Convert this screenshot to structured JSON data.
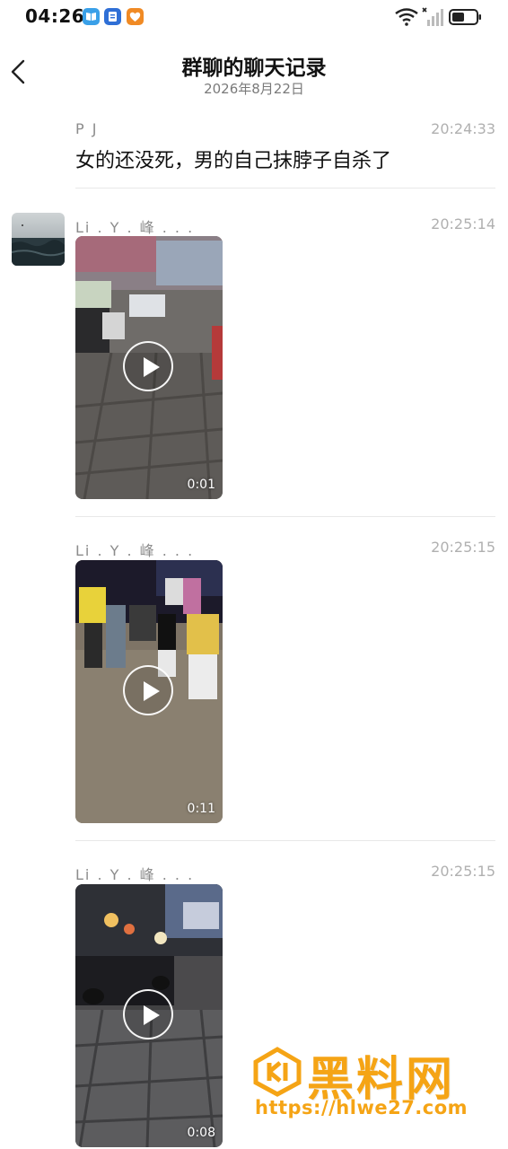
{
  "status_bar": {
    "time": "04:26",
    "app_icons": [
      "book-icon",
      "notes-icon",
      "heart-icon"
    ],
    "signal_icons": [
      "wifi-icon",
      "no-sim-signal-icon",
      "battery-icon"
    ]
  },
  "header": {
    "title": "群聊的聊天记录",
    "date": "2026年8月22日"
  },
  "messages": [
    {
      "sender": "P J",
      "time": "20:24:33",
      "text": "女的还没死，男的自己抹脖子自杀了"
    },
    {
      "sender": "Li . Y . 峰 . . .",
      "time": "20:25:14",
      "video_duration": "0:01"
    },
    {
      "sender": "Li . Y . 峰 . . .",
      "time": "20:25:15",
      "video_duration": "0:11"
    },
    {
      "sender": "Li . Y . 峰 . . .",
      "time": "20:25:15",
      "video_duration": "0:08"
    }
  ],
  "watermark": {
    "name": "黑料网",
    "url": "https://hlwe27.com"
  },
  "colors": {
    "background": "#ffffff",
    "watermark": "#f5a415",
    "secondary_text": "#8c8c8c"
  }
}
